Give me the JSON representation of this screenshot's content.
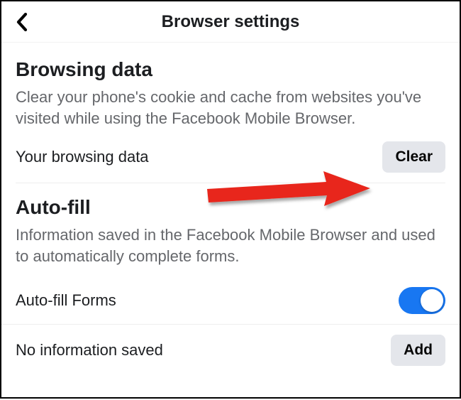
{
  "header": {
    "title": "Browser settings"
  },
  "browsing": {
    "title": "Browsing data",
    "description": "Clear your phone's cookie and cache from websites you've visited while using the Facebook Mobile Browser.",
    "row_label": "Your browsing data",
    "clear_label": "Clear"
  },
  "autofill": {
    "title": "Auto-fill",
    "description": "Information saved in the Facebook Mobile Browser and used to automatically complete forms.",
    "forms_label": "Auto-fill Forms",
    "noinfo_label": "No information saved",
    "add_label": "Add"
  },
  "colors": {
    "accent": "#1877f2",
    "grey_button": "#e4e6eb",
    "text_secondary": "#65676b",
    "arrow": "#e8271a"
  }
}
